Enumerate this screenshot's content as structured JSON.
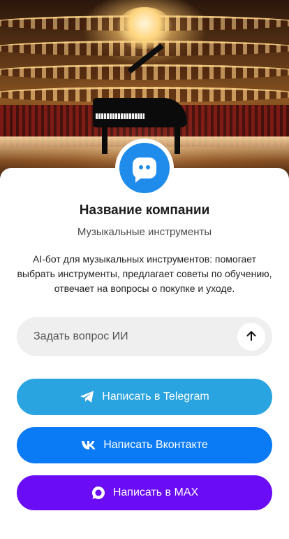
{
  "company": {
    "name": "Название компании",
    "category": "Музыкальные инструменты",
    "description": "AI-бот для музыкальных инструментов: помогает выбрать инструменты, предлагает советы по обучению, отвечает на вопросы о покупке и уходе."
  },
  "hero": {
    "image_subject": "concert hall with grand piano",
    "avatar_icon": "chat-bot-icon",
    "avatar_color": "#1f8ceb"
  },
  "ask": {
    "placeholder": "Задать вопрос ИИ",
    "value": "",
    "send_icon": "arrow-up-icon"
  },
  "actions": {
    "telegram": {
      "label": "Написать в Telegram",
      "icon": "telegram-icon",
      "color": "#2aa3e1"
    },
    "vk": {
      "label": "Написать Вконтакте",
      "icon": "vk-icon",
      "color": "#0a7bf5"
    },
    "max": {
      "label": "Написать в MAX",
      "icon": "max-icon",
      "color": "#6a0cf5"
    }
  }
}
